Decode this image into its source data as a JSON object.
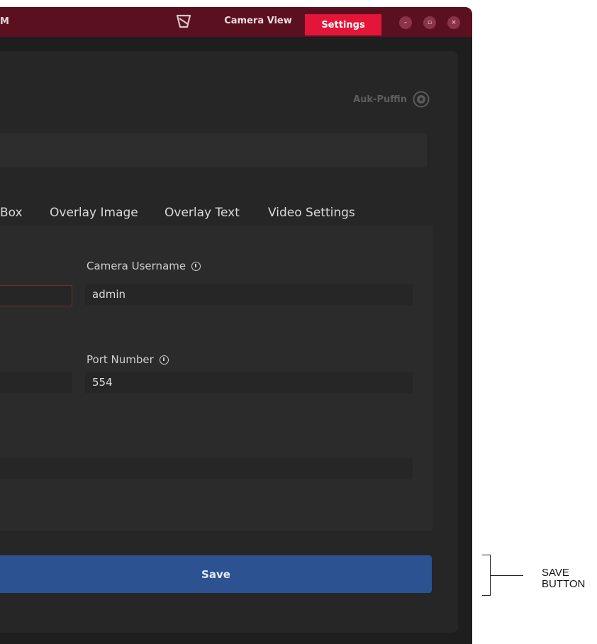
{
  "titlebar": {
    "app_title": "M",
    "logo_icon": "app-logo-icon",
    "nav": {
      "camera_view": "Camera View",
      "settings": "Settings"
    },
    "window_controls": {
      "minimize": "–",
      "maximize": "▫",
      "close": "×"
    },
    "colors": {
      "titlebar_bg": "#5b1020",
      "settings_active": "#e3163a"
    }
  },
  "header": {
    "brand_label": "Auk-Puffin",
    "brand_icon": "camera-lens-icon"
  },
  "tabs": [
    {
      "label": "Box"
    },
    {
      "label": "Overlay Image"
    },
    {
      "label": "Overlay Text"
    },
    {
      "label": "Video Settings"
    }
  ],
  "form": {
    "camera_username": {
      "label": "Camera Username",
      "value": "admin",
      "info_icon": "info-icon"
    },
    "port_number": {
      "label": "Port Number",
      "value": "554",
      "info_icon": "info-icon"
    }
  },
  "save_button": {
    "label": "Save",
    "color": "#2c5292"
  },
  "annotation": {
    "text": "SAVE BUTTON"
  }
}
